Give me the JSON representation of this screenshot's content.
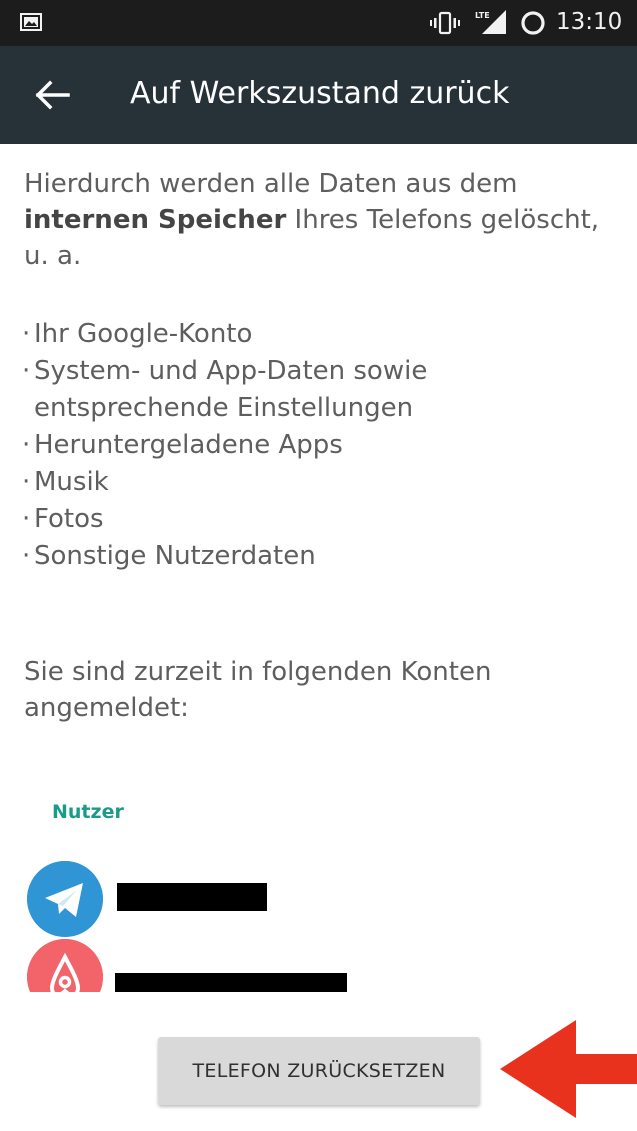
{
  "status_bar": {
    "time": "13:10",
    "icons": [
      "image-notification-icon",
      "vibrate-icon",
      "lte-signal-icon",
      "battery-ring-icon"
    ]
  },
  "app_bar": {
    "title": "Auf Werkszustand zurück",
    "back_icon": "arrow-left-icon",
    "background": "#263238"
  },
  "content": {
    "intro_before": "Hierdurch werden alle Daten aus dem ",
    "intro_bold": "internen Speicher",
    "intro_after": " Ihres Telefons gelöscht, u. a.",
    "bullets": [
      "Ihr Google-Konto",
      "System- und App-Daten sowie",
      "entsprechende Einstellungen",
      "Heruntergeladene Apps",
      "Musik",
      "Fotos",
      "Sonstige Nutzerdaten"
    ],
    "accounts_text": "Sie sind zurzeit in folgenden Konten angemeldet:",
    "users_label": "Nutzer",
    "accounts": [
      {
        "icon": "telegram-icon",
        "name": "",
        "color": "#2f95d4"
      },
      {
        "icon": "airbnb-icon",
        "name": "",
        "color": "#f2646a"
      }
    ]
  },
  "reset_button": {
    "label": "TELEFON ZURÜCKSETZEN"
  },
  "annotation": {
    "icon": "red-arrow-icon",
    "color": "#e8321e"
  },
  "colors": {
    "status_bar": "#1c1c1c",
    "text": "#5e5e5e",
    "accent": "#1a9a88",
    "button": "#d9d9d9"
  }
}
